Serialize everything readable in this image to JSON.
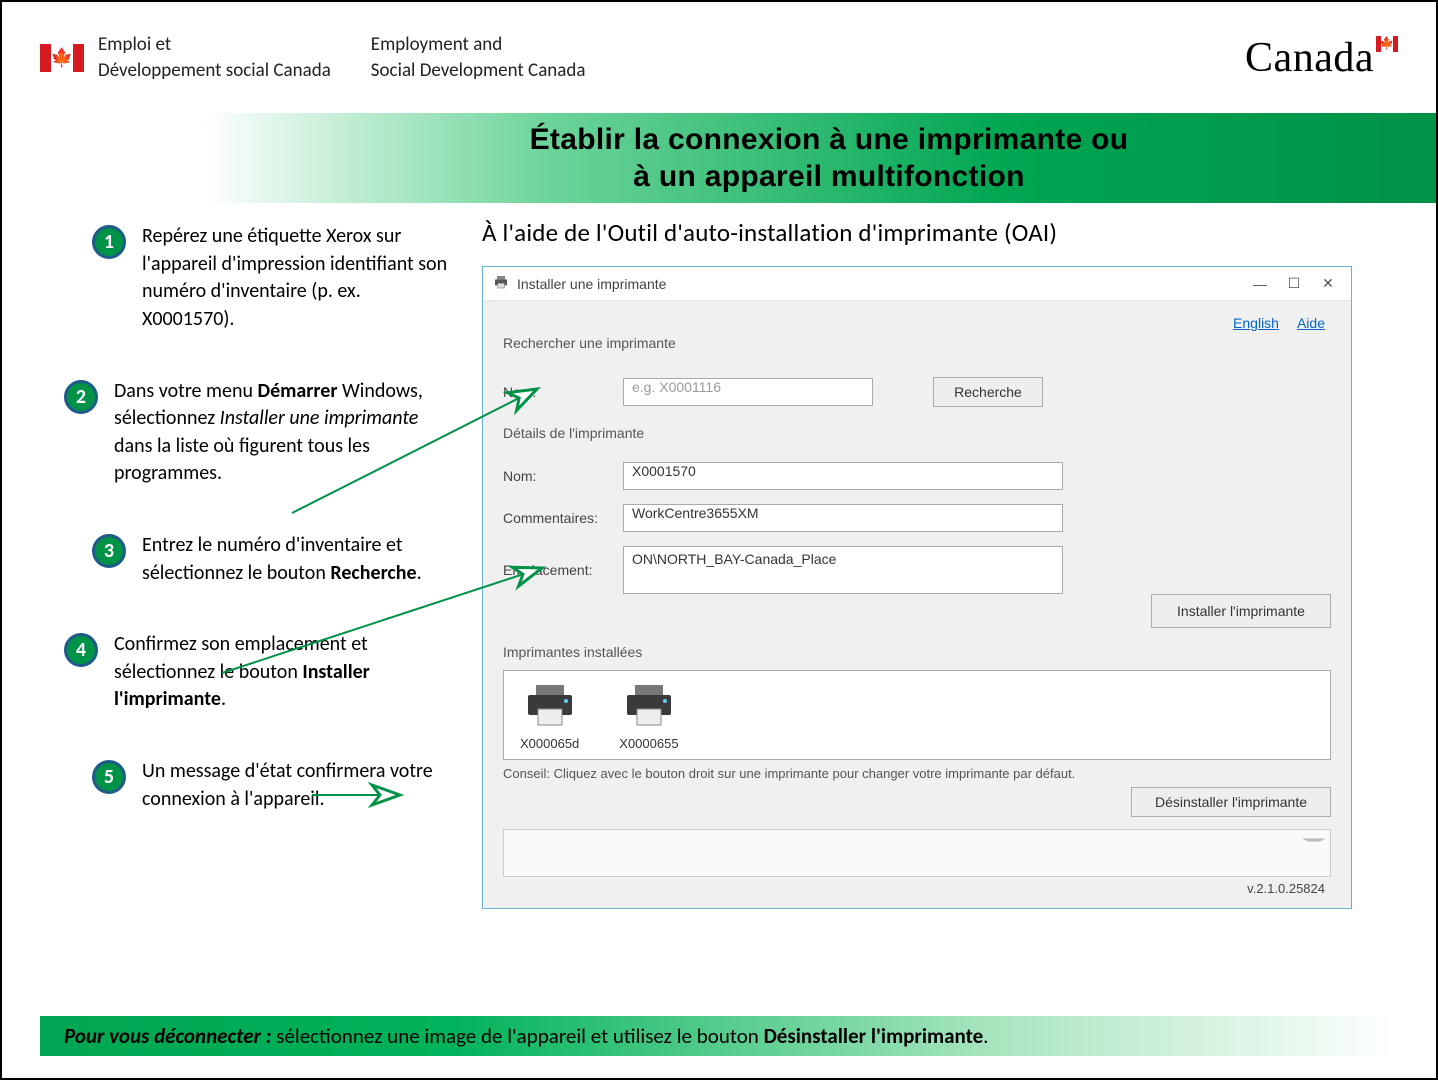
{
  "header": {
    "dept_fr_line1": "Emploi et",
    "dept_fr_line2": "Développement social Canada",
    "dept_en_line1": "Employment and",
    "dept_en_line2": "Social Development Canada",
    "wordmark": "Canada"
  },
  "title_line1": "Établir la connexion à une imprimante ou",
  "title_line2": "à un appareil multifonction",
  "subtitle": "À l'aide de l'Outil d'auto-installation d'imprimante (OAI)",
  "steps": {
    "s1": "Repérez une étiquette Xerox sur l'appareil d'impression identifiant son numéro d'inventaire (p. ex. X0001570).",
    "s2_a": "Dans votre menu ",
    "s2_bold1": "Démarrer",
    "s2_b": " Windows, sélectionnez ",
    "s2_italic": "Installer une imprimante",
    "s2_c": " dans la liste où figurent tous les programmes.",
    "s3_a": "Entrez le numéro d'inventaire et sélectionnez le bouton ",
    "s3_bold": "Recherche",
    "s3_b": ".",
    "s4_a": "Confirmez son emplacement et sélectionnez le bouton ",
    "s4_bold": "Installer l'imprimante",
    "s4_b": ".",
    "s5": "Un message d'état confirmera votre connexion à l'appareil."
  },
  "oai": {
    "window_title": "Installer une imprimante",
    "link_english": "English",
    "link_help": "Aide",
    "group_search": "Rechercher une imprimante",
    "label_nom": "Nom:",
    "search_placeholder": "e.g. X0001116",
    "btn_search": "Recherche",
    "group_details": "Détails de l'imprimante",
    "label_comments": "Commentaires:",
    "label_location": "Emplacement:",
    "detail_nom": "X0001570",
    "detail_comments": "WorkCentre3655XM",
    "detail_location": "ON\\NORTH_BAY-Canada_Place",
    "btn_install": "Installer l'imprimante",
    "group_installed": "Imprimantes installées",
    "printer1": "X000065d",
    "printer2": "X0000655",
    "tip": "Conseil: Cliquez avec le bouton droit sur une imprimante pour changer votre imprimante par défaut.",
    "btn_uninstall": "Désinstaller l'imprimante",
    "version": "v.2.1.0.25824"
  },
  "footer": {
    "lead": "Pour vous déconnecter : ",
    "text_a": "sélectionnez une image de l'appareil et utilisez le bouton ",
    "bold": "Désinstaller l'imprimante",
    "text_b": "."
  }
}
